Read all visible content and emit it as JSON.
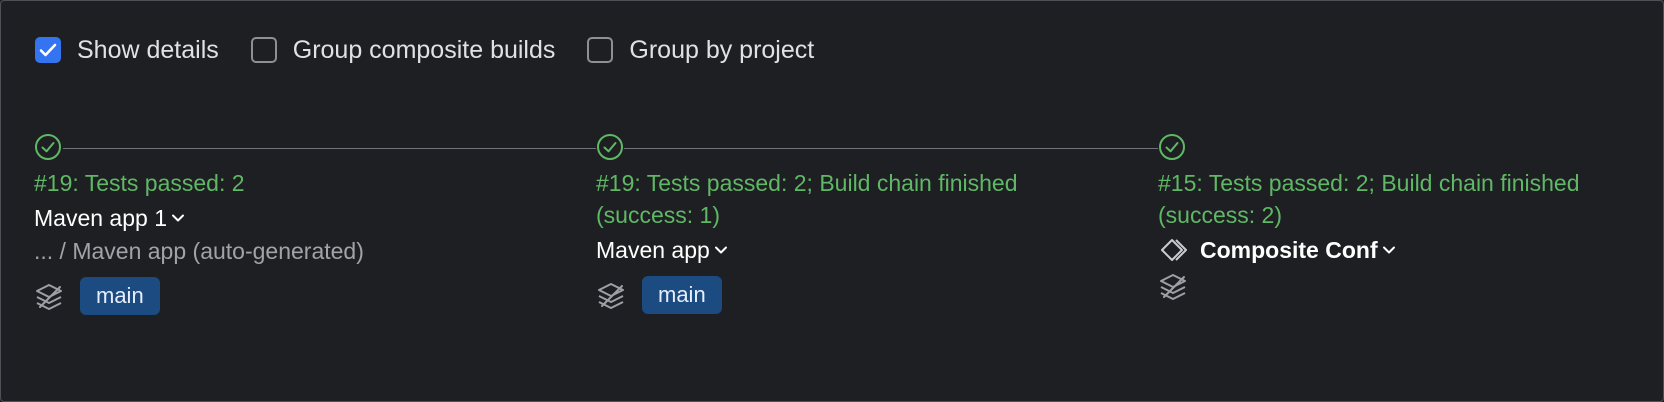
{
  "options": {
    "show_details": {
      "label": "Show details",
      "checked": true
    },
    "group_composite": {
      "label": "Group composite builds",
      "checked": false
    },
    "group_project": {
      "label": "Group by project",
      "checked": false
    }
  },
  "builds": [
    {
      "status": "#19: Tests passed: 2",
      "name": "Maven app 1",
      "path": "... / Maven app (auto-generated)",
      "branch": "main"
    },
    {
      "status_line1": "#19: Tests passed: 2; Build chain finished",
      "status_line2": "(success: 1)",
      "name": "Maven app",
      "branch": "main"
    },
    {
      "status_line1": "#15: Tests passed: 2; Build chain finished",
      "status_line2": "(success: 2)",
      "name": "Composite Conf"
    }
  ],
  "icons": {
    "status": "check-circle-icon",
    "chain": "build-chain-icon",
    "composite": "composite-build-icon",
    "expand": "chevron-down-icon"
  },
  "colors": {
    "background": "#1e1f22",
    "success": "#5fb865",
    "checkbox": "#3574f0",
    "branch_badge": "#1c4b82"
  }
}
